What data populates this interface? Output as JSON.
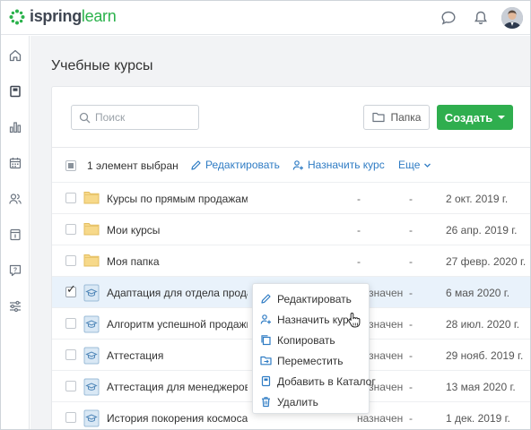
{
  "app": {
    "logo_part1": "ispring",
    "logo_part2": "learn"
  },
  "colors": {
    "brand_green": "#2fae4e",
    "link_blue": "#2f7cc4",
    "selected_row": "#e9f2fb",
    "folder_yellow": "#f7d98a"
  },
  "header": {
    "icons": [
      "chat-icon",
      "bell-icon",
      "user-avatar"
    ]
  },
  "sidebar": {
    "items": [
      "home-icon",
      "courses-icon",
      "reports-icon",
      "calendar-icon",
      "users-icon",
      "catalog-icon",
      "help-icon",
      "settings-icon"
    ]
  },
  "page": {
    "title": "Учебные курсы"
  },
  "toolbar": {
    "search_placeholder": "Поиск",
    "folder_label": "Папка",
    "create_label": "Создать"
  },
  "selection_bar": {
    "count_text": "1 элемент выбран",
    "edit_label": "Редактировать",
    "assign_label": "Назначить курс",
    "more_label": "Еще"
  },
  "rows": [
    {
      "type": "folder",
      "name": "Курсы по прямым продажам",
      "col1": "-",
      "col2": "-",
      "date": "2 окт. 2019 г.",
      "checked": false
    },
    {
      "type": "folder",
      "name": "Мои курсы",
      "col1": "-",
      "col2": "-",
      "date": "26 апр. 2019 г.",
      "checked": false
    },
    {
      "type": "folder",
      "name": "Моя папка",
      "col1": "-",
      "col2": "-",
      "date": "27 февр. 2020 г.",
      "checked": false
    },
    {
      "type": "course",
      "name": "Адаптация для отдела продаж",
      "col1": "назначен",
      "col2": "-",
      "date": "6 мая 2020 г.",
      "checked": true
    },
    {
      "type": "course",
      "name": "Алгоритм успешной продажи",
      "col1": "назначен",
      "col2": "-",
      "date": "28 июл. 2020 г.",
      "checked": false
    },
    {
      "type": "course",
      "name": "Аттестация",
      "col1": "назначен",
      "col2": "-",
      "date": "29 нояб. 2019 г.",
      "checked": false
    },
    {
      "type": "course",
      "name": "Аттестация для менеджеров",
      "col1": "назначен",
      "col2": "-",
      "date": "13 мая 2020 г.",
      "checked": false
    },
    {
      "type": "course",
      "name": "История покорения космоса",
      "col1": "назначен",
      "col2": "-",
      "date": "1 дек. 2019 г.",
      "checked": false
    }
  ],
  "context_menu": {
    "items": [
      {
        "label": "Редактировать",
        "icon": "pencil-icon"
      },
      {
        "label": "Назначить курс",
        "icon": "assign-user-icon"
      },
      {
        "label": "Копировать",
        "icon": "copy-icon"
      },
      {
        "label": "Переместить",
        "icon": "move-folder-icon"
      },
      {
        "label": "Добавить в Каталог",
        "icon": "catalog-add-icon"
      },
      {
        "label": "Удалить",
        "icon": "trash-icon"
      }
    ]
  }
}
